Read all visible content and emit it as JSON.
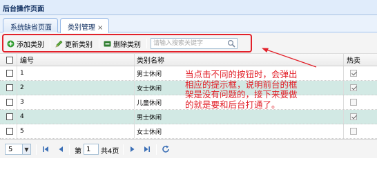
{
  "window": {
    "title": "后台操作页面"
  },
  "tabs": [
    {
      "label": "系统缺省页面",
      "active": false
    },
    {
      "label": "类别管理",
      "active": true,
      "close": "×"
    }
  ],
  "toolbar": {
    "add_label": "添加类别",
    "update_label": "更新类别",
    "delete_label": "删除类别",
    "search_placeholder": "请输入搜索关键字"
  },
  "grid": {
    "columns": [
      "编号",
      "类别名称",
      "热卖"
    ],
    "rows": [
      {
        "id": "1",
        "name": "男士休闲",
        "hot": true,
        "checked": false,
        "alt": false
      },
      {
        "id": "2",
        "name": "女士休闲",
        "hot": true,
        "checked": false,
        "alt": true
      },
      {
        "id": "3",
        "name": "儿童休闲",
        "hot": false,
        "checked": false,
        "alt": false
      },
      {
        "id": "4",
        "name": "男士休闲",
        "hot": true,
        "checked": false,
        "alt": true
      },
      {
        "id": "5",
        "name": "女士休闲",
        "hot": false,
        "checked": false,
        "alt": false
      }
    ]
  },
  "pager": {
    "page_size": "5",
    "page_prefix": "第",
    "current_page": "1",
    "total_pages": "共4页"
  },
  "annotation": {
    "text": "当点击不同的按钮时，会弹出\n相应的提示框，说明前台的框\n架是没有问题的，接下来要做\n的就是要和后台打通了。",
    "color": "#e2212a"
  },
  "colors": {
    "accent_red": "#e2212a",
    "row_alt": "#d2e9e4",
    "tab_border": "#95b8e7"
  },
  "icons": {
    "add": "plus-icon",
    "update": "pencil-icon",
    "delete": "minus-icon",
    "search": "magnifier-icon"
  }
}
